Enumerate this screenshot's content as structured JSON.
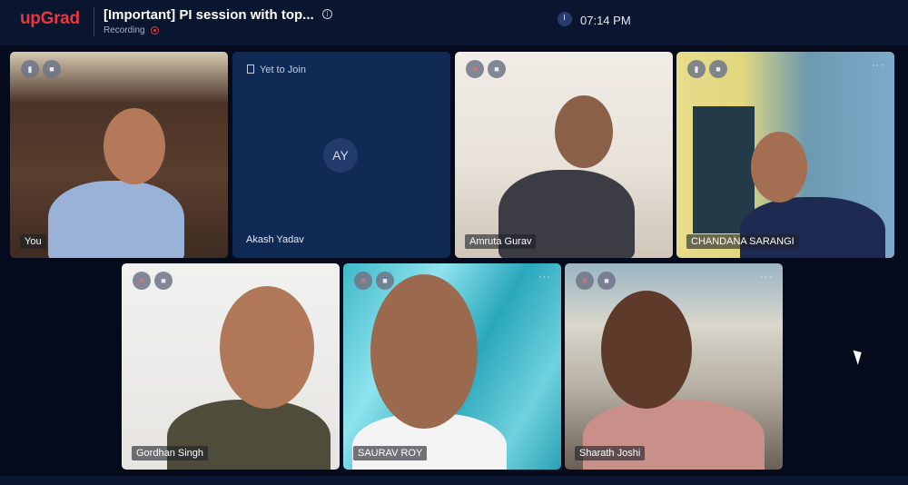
{
  "app": {
    "logo": "upGrad",
    "title": "[Important] PI session with top...",
    "recording_label": "Recording",
    "time": "07:14 PM"
  },
  "participants": [
    {
      "name": "You",
      "mic": "on",
      "camera": "on"
    },
    {
      "name": "Akash Yadav",
      "initials": "AY",
      "status": "Yet to Join"
    },
    {
      "name": "Amruta Gurav",
      "mic": "muted",
      "camera": "on"
    },
    {
      "name": "CHANDANA SARANGI",
      "mic": "on",
      "camera": "on"
    },
    {
      "name": "Gordhan Singh",
      "mic": "muted",
      "camera": "on"
    },
    {
      "name": "SAURAV ROY",
      "mic": "muted",
      "camera": "on"
    },
    {
      "name": "Sharath Joshi",
      "mic": "muted",
      "camera": "on"
    }
  ],
  "icons": {
    "more": "more-icon",
    "camera": "camera-icon",
    "mic": "mic-icon",
    "mic_muted": "mic-muted-icon",
    "info": "info-icon",
    "clock": "clock-icon",
    "pointer": "cursor-icon"
  },
  "colors": {
    "brand": "#e8383d",
    "topbar": "#0a1530",
    "background": "#050a1c",
    "muted": "#ff6a6a"
  }
}
